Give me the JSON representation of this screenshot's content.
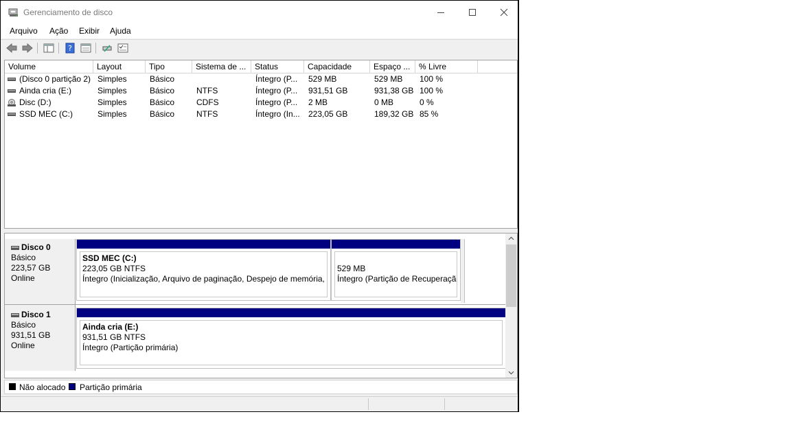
{
  "window": {
    "title": "Gerenciamento de disco"
  },
  "menu": [
    "Arquivo",
    "Ação",
    "Exibir",
    "Ajuda"
  ],
  "columns": [
    "Volume",
    "Layout",
    "Tipo",
    "Sistema de ...",
    "Status",
    "Capacidade",
    "Espaço ...",
    "% Livre"
  ],
  "volumes": [
    {
      "volume": "(Disco 0 partição 2)",
      "layout": "Simples",
      "tipo": "Básico",
      "fs": "",
      "status": "Íntegro (P...",
      "capacidade": "529 MB",
      "espaco": "529 MB",
      "livre": "100 %",
      "icon": "disk-volume-icon"
    },
    {
      "volume": "Ainda cria (E:)",
      "layout": "Simples",
      "tipo": "Básico",
      "fs": "NTFS",
      "status": "Íntegro (P...",
      "capacidade": "931,51 GB",
      "espaco": "931,38 GB",
      "livre": "100 %",
      "icon": "disk-volume-icon"
    },
    {
      "volume": "Disc (D:)",
      "layout": "Simples",
      "tipo": "Básico",
      "fs": "CDFS",
      "status": "Íntegro (P...",
      "capacidade": "2 MB",
      "espaco": "0 MB",
      "livre": "0 %",
      "icon": "cd-volume-icon"
    },
    {
      "volume": "SSD MEC (C:)",
      "layout": "Simples",
      "tipo": "Básico",
      "fs": "NTFS",
      "status": "Íntegro (In...",
      "capacidade": "223,05 GB",
      "espaco": "189,32 GB",
      "livre": "85 %",
      "icon": "disk-volume-icon"
    }
  ],
  "disks": [
    {
      "name": "Disco 0",
      "type": "Básico",
      "size": "223,57 GB",
      "state": "Online",
      "partitions": [
        {
          "name": "SSD MEC  (C:)",
          "size": "223,05 GB NTFS",
          "status": "Íntegro (Inicialização, Arquivo de paginação, Despejo de memória, P"
        },
        {
          "name": "",
          "size": "529 MB",
          "status": "Íntegro (Partição de Recuperação"
        }
      ]
    },
    {
      "name": "Disco 1",
      "type": "Básico",
      "size": "931,51 GB",
      "state": "Online",
      "partitions": [
        {
          "name": "Ainda cria  (E:)",
          "size": "931,51 GB NTFS",
          "status": "Íntegro (Partição primária)"
        }
      ]
    }
  ],
  "legend": [
    {
      "label": "Não alocado",
      "color": "#000000"
    },
    {
      "label": "Partição primária",
      "color": "#000080"
    }
  ]
}
